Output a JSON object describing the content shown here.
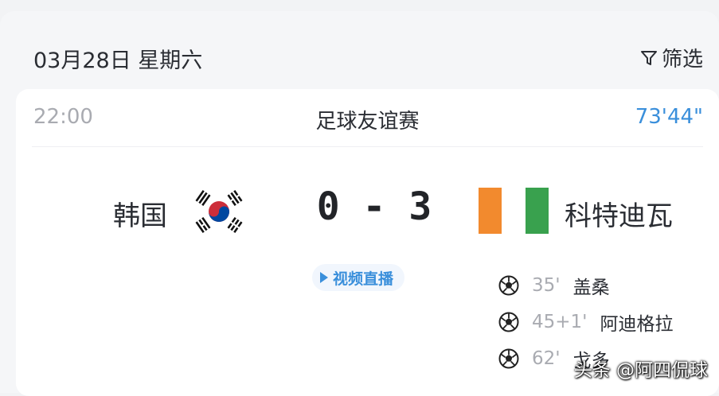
{
  "header": {
    "date": "03月28日 星期六",
    "filter_label": "筛选"
  },
  "match": {
    "time": "22:00",
    "league": "足球友谊赛",
    "clock": "73'44\"",
    "home": {
      "name": "韩国",
      "flag_icon": "south-korea-flag-icon"
    },
    "away": {
      "name": "科特迪瓦",
      "flag_icon": "ivory-coast-flag-icon"
    },
    "score": "0 - 3",
    "live_label": "视频直播",
    "goals": [
      {
        "minute": "35'",
        "scorer": "盖桑"
      },
      {
        "minute": "45+1'",
        "scorer": "阿迪格拉"
      },
      {
        "minute": "62'",
        "scorer": "戈多"
      }
    ]
  },
  "watermark": "头条 @阿四侃球",
  "colors": {
    "accent_blue": "#3a8fdb",
    "ivory_orange": "#f28a2e",
    "ivory_green": "#39a14e",
    "korea_red": "#cd2e3a",
    "korea_blue": "#0047a0"
  }
}
